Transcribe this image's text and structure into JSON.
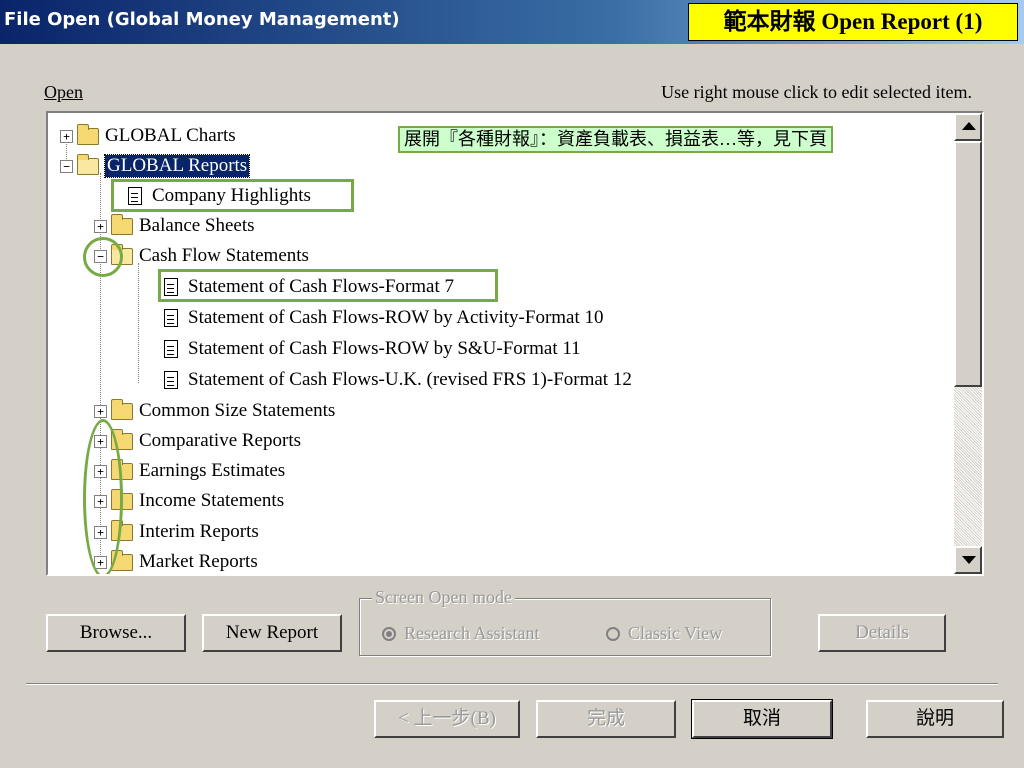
{
  "window": {
    "title": "File Open   (Global Money Management)",
    "badge": "範本財報 Open Report (1)"
  },
  "labels": {
    "open": "Open",
    "hint": "Use right mouse click to edit selected item.",
    "callout": "展開『各種財報』：資產負載表、損益表…等，見下頁"
  },
  "tree": [
    {
      "label": "GLOBAL Charts",
      "type": "folder",
      "expander": "+",
      "level": 0
    },
    {
      "label": "GLOBAL Reports",
      "type": "folder-open",
      "expander": "−",
      "level": 0,
      "selected": true
    },
    {
      "label": "Company Highlights",
      "type": "doc",
      "level": 1
    },
    {
      "label": "Balance Sheets",
      "type": "folder",
      "expander": "+",
      "level": 1
    },
    {
      "label": "Cash Flow Statements",
      "type": "folder-open",
      "expander": "−",
      "level": 1
    },
    {
      "label": "Statement of Cash Flows-Format 7",
      "type": "doc",
      "level": 2
    },
    {
      "label": "Statement of Cash Flows-ROW by Activity-Format 10",
      "type": "doc",
      "level": 2
    },
    {
      "label": "Statement of Cash Flows-ROW by S&U-Format 11",
      "type": "doc",
      "level": 2
    },
    {
      "label": "Statement of Cash Flows-U.K. (revised FRS 1)-Format 12",
      "type": "doc",
      "level": 2
    },
    {
      "label": "Common Size Statements",
      "type": "folder",
      "expander": "+",
      "level": 1
    },
    {
      "label": "Comparative Reports",
      "type": "folder",
      "expander": "+",
      "level": 1
    },
    {
      "label": "Earnings Estimates",
      "type": "folder",
      "expander": "+",
      "level": 1
    },
    {
      "label": "Income Statements",
      "type": "folder",
      "expander": "+",
      "level": 1
    },
    {
      "label": "Interim Reports",
      "type": "folder",
      "expander": "+",
      "level": 1
    },
    {
      "label": "Market Reports",
      "type": "folder",
      "expander": "+",
      "level": 1
    }
  ],
  "buttons": {
    "browse": "Browse...",
    "new_report": "New Report",
    "details": "Details",
    "back": "< 上一步(B)",
    "finish": "完成",
    "cancel": "取消",
    "help": "說明"
  },
  "screen_open_mode": {
    "legend": "Screen Open mode",
    "options": [
      "Research Assistant",
      "Classic View"
    ],
    "selected": "Research Assistant"
  },
  "colors": {
    "title_bar": "#0a246a",
    "badge_bg": "#ffff00",
    "callout_bg": "#ccffcc",
    "highlight_outline": "#77aa44",
    "selection": "#0a246a"
  }
}
